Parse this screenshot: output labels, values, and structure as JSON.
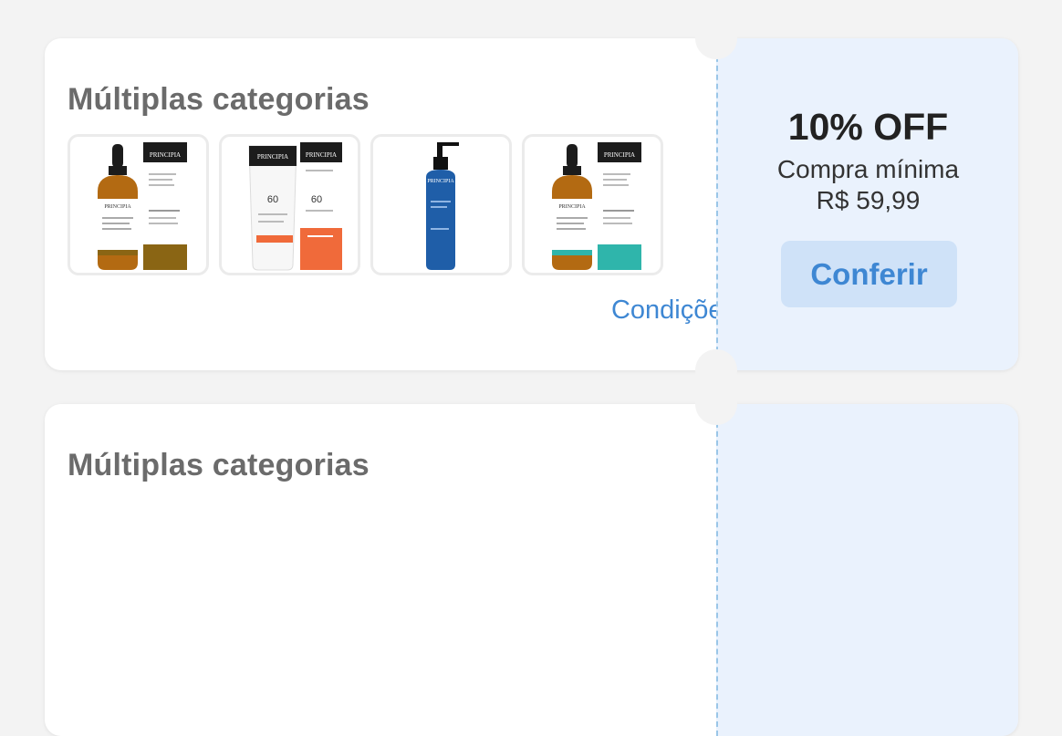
{
  "coupons": [
    {
      "title": "Múltiplas categorias",
      "conditions_label": "Condições",
      "discount": "10% OFF",
      "min_label": "Compra mínima",
      "min_value": "R$ 59,99",
      "cta_label": "Conferir",
      "products": [
        {
          "name": "serum-dropper-bottle-gold",
          "accent": "#8a6514"
        },
        {
          "name": "sunscreen-tube-spf60",
          "accent": "#f06a3a"
        },
        {
          "name": "blue-pump-bottle",
          "accent": "#1f5ea8"
        },
        {
          "name": "serum-dropper-bottle-teal",
          "accent": "#2fb5ab"
        }
      ]
    },
    {
      "title": "Múltiplas categorias"
    }
  ],
  "colors": {
    "background": "#f3f3f3",
    "card": "#ffffff",
    "panel": "#eaf2fd",
    "accent": "#3e87d3",
    "button": "#cfe2f8"
  }
}
